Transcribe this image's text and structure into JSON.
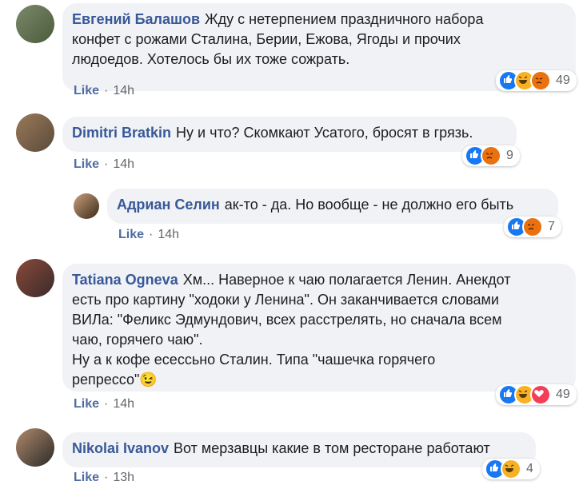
{
  "comments": [
    {
      "name": "Евгений Балашов",
      "text": "Жду с нетерпением праздничного набора\nконфет с рожами Сталина, Берии, Ежова, Ягоды и прочих\nлюдоедов. Хотелось бы их тоже сожрать.",
      "like": "Like",
      "time": "14h",
      "count": "49",
      "reactions": [
        "like-icon",
        "haha-icon",
        "angry-icon"
      ]
    },
    {
      "name": "Dimitri Bratkin",
      "text": "Ну и что? Скомкают Усатого, бросят в грязь.",
      "like": "Like",
      "time": "14h",
      "count": "9",
      "reactions": [
        "like-icon",
        "angry-icon"
      ]
    },
    {
      "name": "Адриан Селин",
      "text": "ак-то - да. Но вообще - не должно его быть",
      "like": "Like",
      "time": "14h",
      "count": "7",
      "reactions": [
        "like-icon",
        "angry-icon"
      ]
    },
    {
      "name": "Tatiana Ogneva",
      "text": "Хм... Наверное к чаю полагается Ленин. Анекдот\nесть про картину \"ходоки у Ленина\". Он заканчивается словами\nВИЛа: \"Феликс Эдмундович, всех расстрелять, но сначала всем\nчаю, горячего чаю\".\nНу а к кофе есессьно Сталин. Типа \"чашечка горячего\nрепрессо\"",
      "emoji": "😉",
      "like": "Like",
      "time": "14h",
      "count": "49",
      "reactions": [
        "like-icon",
        "haha-icon",
        "love-icon"
      ]
    },
    {
      "name": "Nikolai Ivanov",
      "text": "Вот мерзавцы какие в том ресторане работают",
      "like": "Like",
      "time": "13h",
      "count": "4",
      "reactions": [
        "like-icon",
        "haha-icon"
      ]
    }
  ],
  "colors": {
    "name": "#385898",
    "like": "#4e6ca3",
    "bubble": "#f0f2f5",
    "meta": "#65676b"
  }
}
